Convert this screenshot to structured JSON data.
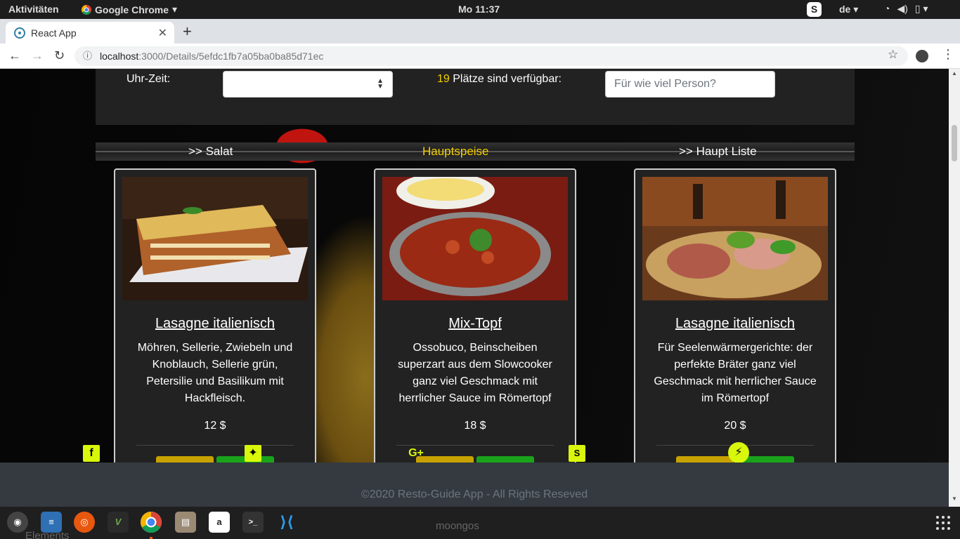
{
  "topbar": {
    "activities": "Aktivitäten",
    "app_name": "Google Chrome",
    "clock": "Mo 11:37",
    "lang": "de"
  },
  "browser": {
    "tab_title": "React App",
    "url_host": "localhost",
    "url_path": ":3000/Details/5efdc1fb7a05ba0ba85d71ec"
  },
  "booking": {
    "time_label": "Uhr-Zeit:",
    "seats_count": "19",
    "seats_label": " Plätze sind verfügbar:",
    "persons_placeholder": "Für wie viel Person?"
  },
  "categories": {
    "left": ">> Salat",
    "center": "Hauptspeise",
    "right": ">> Haupt Liste",
    "active_color": "#f5d000"
  },
  "dishes": [
    {
      "name": "Lasagne italienisch",
      "description": "Möhren, Sellerie, Zwiebeln und Knoblauch, Sellerie grün, Petersilie und Basilikum mit Hackfleisch.",
      "price": "12 $"
    },
    {
      "name": "Mix-Topf",
      "description": "Ossobuco, Beinscheiben superzart aus dem Slowcooker ganz viel Geschmack mit herrlicher Sauce im Römertopf",
      "price": "18 $"
    },
    {
      "name": "Lasagne italienisch",
      "description": "Für Seelenwärmergerichte: der perfekte Bräter ganz viel Geschmack mit herrlicher Sauce im Römertopf",
      "price": "20 $"
    }
  ],
  "social_icons": [
    "facebook-icon",
    "twitter-icon",
    "google-plus-icon",
    "skype-icon",
    "messenger-icon"
  ],
  "footer": {
    "copyright": "©2020 Resto-Guide App - All Rights Reseved"
  },
  "dock": {
    "ghost_label_1": "Elements",
    "ghost_label_2": "moongos"
  },
  "colors": {
    "accent_yellow": "#f5d000",
    "social_bg": "#d9f70a",
    "order_btn_yellow": "#c8a200",
    "order_btn_green": "#1aa31a"
  }
}
